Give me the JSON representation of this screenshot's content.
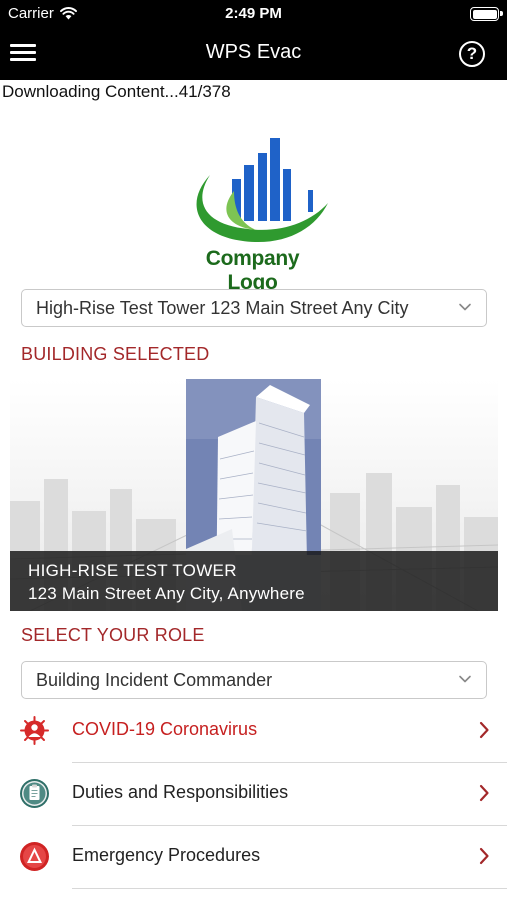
{
  "status_bar": {
    "carrier": "Carrier",
    "time": "2:49 PM"
  },
  "nav": {
    "title": "WPS Evac",
    "menu_icon": "hamburger-menu-icon",
    "help_icon": "help-icon",
    "help_symbol": "?"
  },
  "download_status": "Downloading Content...41/378",
  "logo": {
    "text": "Company Logo"
  },
  "building_select": {
    "value": "High-Rise Test Tower 123 Main Street Any City"
  },
  "building_section": {
    "label": "BUILDING SELECTED",
    "name": "HIGH-RISE TEST TOWER",
    "address": "123 Main Street Any City, Anywhere"
  },
  "role_section": {
    "label": "SELECT YOUR ROLE",
    "value": "Building Incident Commander"
  },
  "menu_items": [
    {
      "label": "COVID-19 Coronavirus",
      "icon": "virus-icon",
      "color": "#c62020"
    },
    {
      "label": "Duties and Responsibilities",
      "icon": "duties-icon",
      "color": "#222222"
    },
    {
      "label": "Emergency Procedures",
      "icon": "emergency-icon",
      "color": "#222222"
    }
  ],
  "colors": {
    "accent": "#a3282a",
    "bar_background": "#000000",
    "logo_green": "#1c6a1c",
    "logo_blue": "#1f62c8"
  }
}
